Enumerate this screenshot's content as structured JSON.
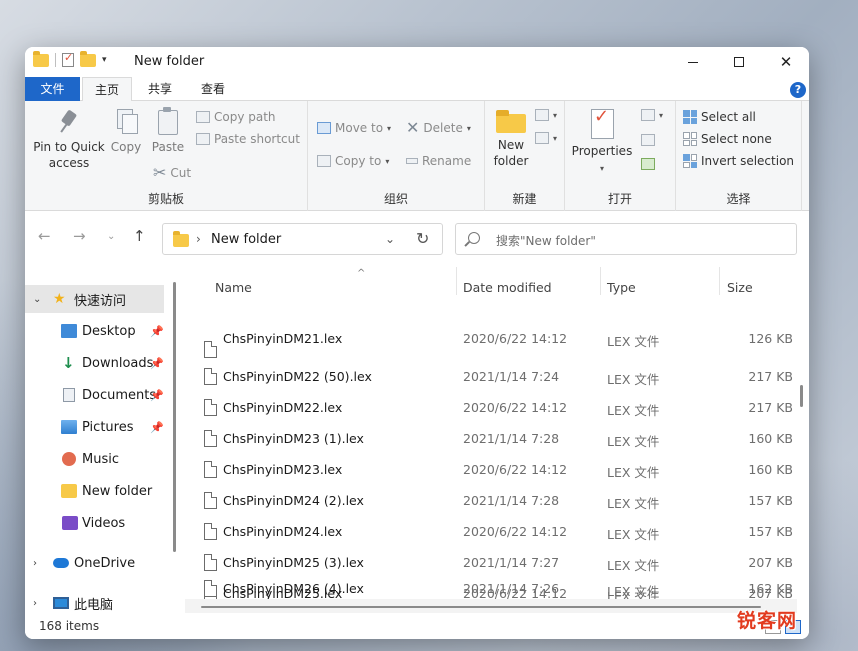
{
  "window": {
    "title": "New folder"
  },
  "tabs": [
    {
      "label": "文件"
    },
    {
      "label": "主页"
    },
    {
      "label": "共享"
    },
    {
      "label": "查看"
    }
  ],
  "help_label": "?",
  "ribbon": {
    "clipboard": {
      "label": "剪贴板",
      "pin": "Pin to Quick access",
      "copy": "Copy",
      "paste": "Paste",
      "copy_path": "Copy path",
      "paste_shortcut": "Paste shortcut",
      "cut": "Cut"
    },
    "organize": {
      "label": "组织",
      "move_to": "Move to",
      "copy_to": "Copy to",
      "delete": "Delete",
      "rename": "Rename"
    },
    "new": {
      "label": "新建",
      "new_folder": "New folder"
    },
    "open": {
      "label": "打开",
      "properties": "Properties"
    },
    "select": {
      "label": "选择",
      "select_all": "Select all",
      "select_none": "Select none",
      "invert": "Invert selection"
    }
  },
  "address": {
    "path": "New folder"
  },
  "search": {
    "placeholder": "搜索\"New folder\""
  },
  "sidebar": {
    "quick_access": "快速访问",
    "items": [
      {
        "label": "Desktop",
        "icon": "desktop-icon",
        "pinned": true
      },
      {
        "label": "Downloads",
        "icon": "download-icon",
        "pinned": true
      },
      {
        "label": "Documents",
        "icon": "documents-icon",
        "pinned": true
      },
      {
        "label": "Pictures",
        "icon": "pictures-icon",
        "pinned": true
      },
      {
        "label": "Music",
        "icon": "music-icon",
        "pinned": false
      },
      {
        "label": "New folder",
        "icon": "folder-icon",
        "pinned": false
      },
      {
        "label": "Videos",
        "icon": "videos-icon",
        "pinned": false
      }
    ],
    "onedrive": "OneDrive",
    "this_pc": "此电脑"
  },
  "columns": {
    "name": "Name",
    "date": "Date modified",
    "type": "Type",
    "size": "Size"
  },
  "files": [
    {
      "name": "ChsPinyinDM21.lex",
      "date": "2020/6/22 14:12",
      "type": "LEX 文件",
      "size": "126 KB"
    },
    {
      "name": "ChsPinyinDM22 (50).lex",
      "date": "2021/1/14 7:24",
      "type": "LEX 文件",
      "size": "217 KB"
    },
    {
      "name": "ChsPinyinDM22.lex",
      "date": "2020/6/22 14:12",
      "type": "LEX 文件",
      "size": "217 KB"
    },
    {
      "name": "ChsPinyinDM23 (1).lex",
      "date": "2021/1/14 7:28",
      "type": "LEX 文件",
      "size": "160 KB"
    },
    {
      "name": "ChsPinyinDM23.lex",
      "date": "2020/6/22 14:12",
      "type": "LEX 文件",
      "size": "160 KB"
    },
    {
      "name": "ChsPinyinDM24 (2).lex",
      "date": "2021/1/14 7:28",
      "type": "LEX 文件",
      "size": "157 KB"
    },
    {
      "name": "ChsPinyinDM24.lex",
      "date": "2020/6/22 14:12",
      "type": "LEX 文件",
      "size": "157 KB"
    },
    {
      "name": "ChsPinyinDM25 (3).lex",
      "date": "2021/1/14 7:27",
      "type": "LEX 文件",
      "size": "207 KB"
    },
    {
      "name": "ChsPinyinDM25.lex",
      "date": "2020/6/22 14:12",
      "type": "LEX 文件",
      "size": "207 KB"
    },
    {
      "name": "ChsPinyinDM26 (4).lex",
      "date": "2021/1/14 7:26",
      "type": "LEX 文件",
      "size": "162 KB"
    }
  ],
  "status": {
    "item_count": "168 items"
  },
  "watermark": "锐客网",
  "colors": {
    "accent": "#1e67c9",
    "folder": "#f7c948"
  }
}
